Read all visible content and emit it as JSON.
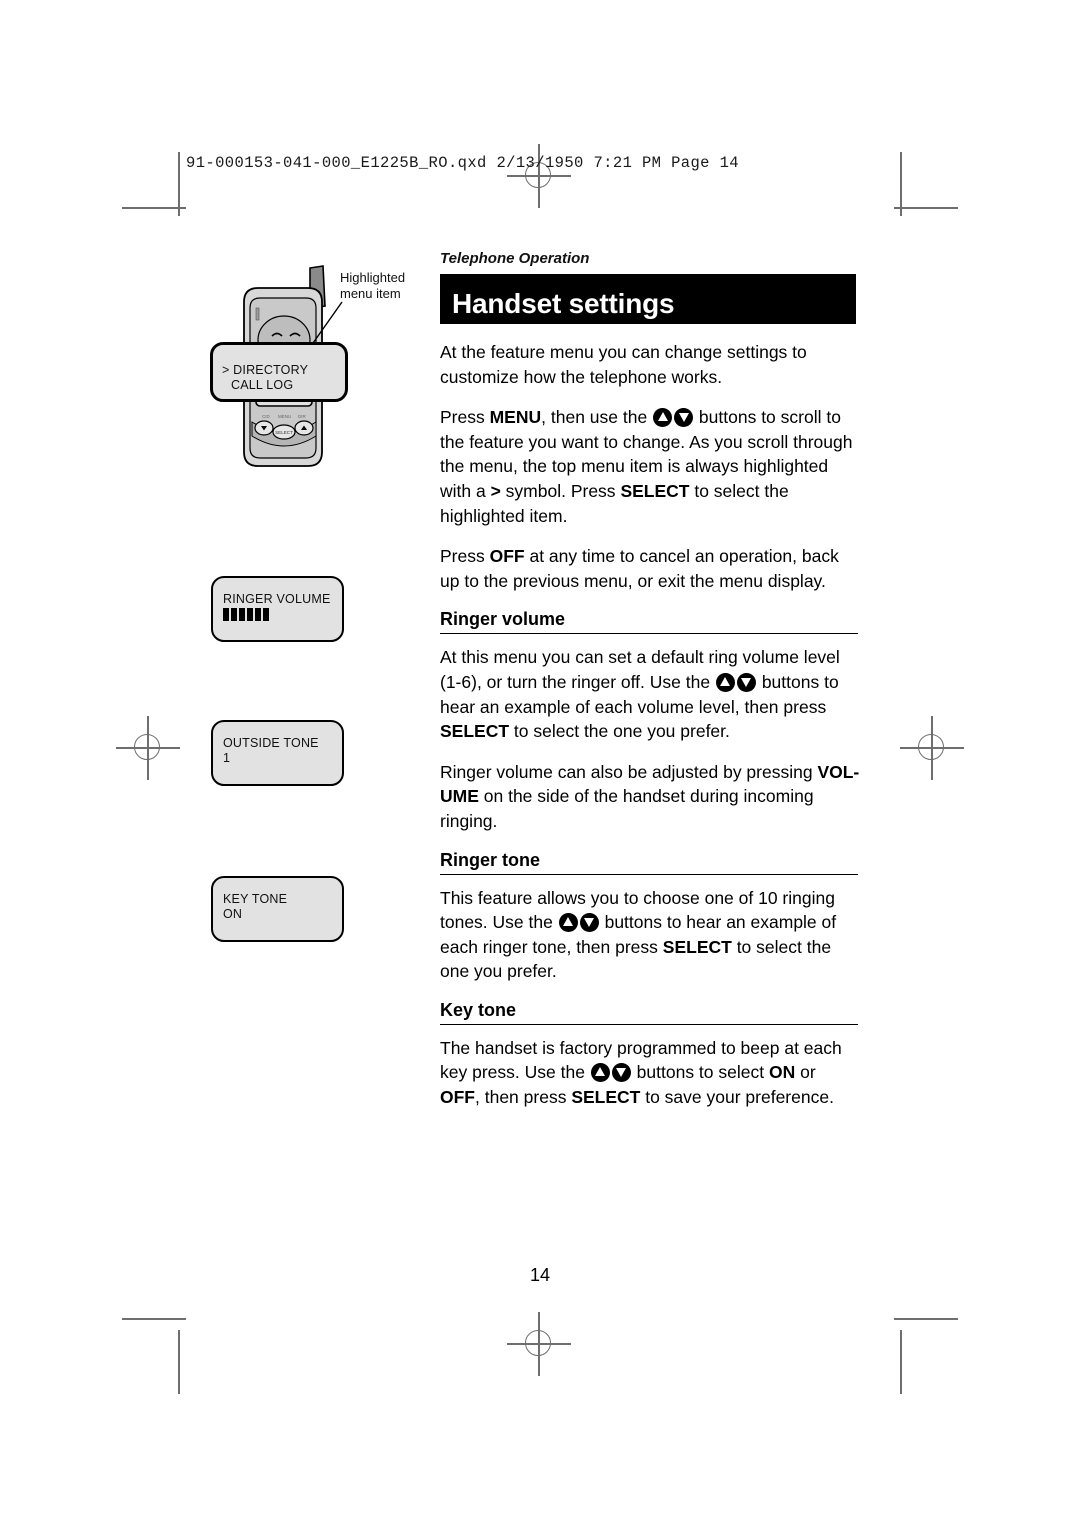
{
  "prepress": {
    "slug": "91-000153-041-000_E1225B_RO.qxd  2/13/1950  7:21 PM  Page 14"
  },
  "page": {
    "running_head": "Telephone Operation",
    "title": "Handset settings",
    "folio": "14"
  },
  "figures": {
    "phone_callout": {
      "label_line1": "Highlighted",
      "label_line2": "menu item",
      "screen_line1": "> DIRECTORY",
      "screen_line2": "CALL LOG",
      "keys": {
        "down": "down-arrow",
        "select": "SELECT",
        "up": "up-arrow"
      }
    },
    "lcd_screens": [
      {
        "name": "ringer-volume-screen",
        "line1": "RINGER VOLUME",
        "line2": "",
        "bars": 6
      },
      {
        "name": "outside-tone-screen",
        "line1": "OUTSIDE TONE",
        "line2": "1",
        "bars": 0
      },
      {
        "name": "key-tone-screen",
        "line1": "KEY TONE",
        "line2": "ON",
        "bars": 0
      }
    ]
  },
  "content": {
    "intro_p1": "At the feature menu you can change settings to customize how the telephone works.",
    "intro_p2_a": "Press ",
    "intro_p2_menu": "MENU",
    "intro_p2_b": ", then use the ",
    "intro_p2_c": " buttons to scroll to the feature you want to change. As you scroll through the menu, the top menu item is always highlighted with a ",
    "intro_p2_symbol": ">",
    "intro_p2_d": " symbol. Press ",
    "intro_p2_select": "SELECT",
    "intro_p2_e": " to select the highlighted item.",
    "intro_p3_a": "Press ",
    "intro_p3_off": "OFF",
    "intro_p3_b": " at any time to cancel an operation, back up to the previous menu, or exit the menu display.",
    "sections": [
      {
        "heading": "Ringer volume",
        "p1_a": "At this menu you can set a default ring volume level (1-6), or turn the ringer off. Use the ",
        "p1_b": " buttons to hear an example of each volume level, then press ",
        "p1_select": "SELECT",
        "p1_c": " to select the one you prefer.",
        "p2_a": "Ringer volume can also be adjusted by pressing ",
        "p2_vol": "VOL-",
        "p2_ume": "UME",
        "p2_b": " on the side of the handset during incoming ringing."
      },
      {
        "heading": "Ringer tone",
        "p1_a": "This feature allows you to choose one of 10 ringing tones. Use the ",
        "p1_b": " buttons to hear an example of each ringer tone, then press ",
        "p1_select": "SELECT",
        "p1_c": " to select the one you prefer."
      },
      {
        "heading": "Key tone",
        "p1_a": "The handset is factory programmed to beep at each key press. Use the ",
        "p1_b": " buttons to select ",
        "p1_on": "ON",
        "p1_or": " or ",
        "p1_off": "OFF",
        "p1_c": ", then press ",
        "p1_select": "SELECT",
        "p1_d": " to save your preference."
      }
    ]
  },
  "colors": {
    "title_bar_bg": "#000000",
    "title_text": "#ffffff",
    "lcd_bg": "#e2e2e2",
    "mark": "#6e6e6e"
  }
}
